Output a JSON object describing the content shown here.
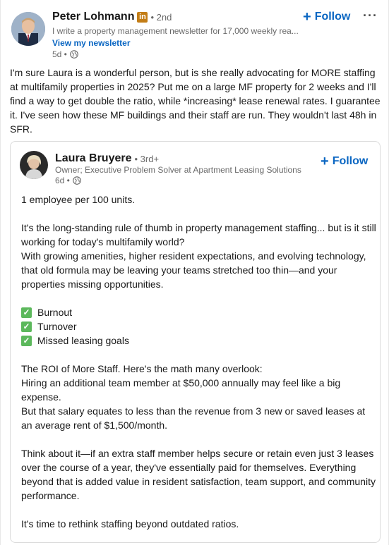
{
  "author": {
    "name": "Peter Lohmann",
    "badge": "in",
    "degree": "• 2nd",
    "headline": "I write a property management newsletter for 17,000 weekly rea...",
    "newsletter_link": "View my newsletter",
    "time": "5d •",
    "follow_label": "Follow",
    "more_icon": "···"
  },
  "post_text": "I'm sure Laura is a wonderful person, but is she really advocating for MORE staffing at multifamily properties in 2025? Put me on a large MF property for 2 weeks and I'll find a way to get double the ratio, while *increasing* lease renewal rates. I guarantee it. I've seen how these MF buildings and their staff are run. They wouldn't last 48h in SFR.",
  "reshared": {
    "name": "Laura Bruyere",
    "degree": "• 3rd+",
    "headline": "Owner; Executive Problem Solver at Apartment Leasing Solutions",
    "time": "6d •",
    "follow_label": "Follow",
    "para1": "1 employee per 100 units.",
    "para2": "It's the long-standing rule of thumb in property management staffing... but is it still working for today's multifamily world?",
    "para3": "With growing amenities, higher resident expectations, and evolving technology, that old formula may be leaving your teams stretched too thin—and your properties missing opportunities.",
    "checklist": [
      "Burnout",
      "Turnover",
      "Missed leasing goals"
    ],
    "para4": "The ROI of More Staff. Here's the math many overlook:",
    "para5": "Hiring an additional team member at $50,000 annually may feel like a big expense.",
    "para6": "But that salary equates to less than the revenue from 3 new or saved leases at an average rent of $1,500/month.",
    "para7": "Think about it—if an extra staff member helps secure or retain even just 3 leases over the course of a year, they've essentially paid for themselves. Everything beyond that is added value in resident satisfaction, team support, and community performance.",
    "para8": "It's time to rethink staffing beyond outdated ratios."
  },
  "colors": {
    "link_blue": "#0a66c2",
    "premium_badge": "#c37d16",
    "check_green": "#5cb85c"
  }
}
